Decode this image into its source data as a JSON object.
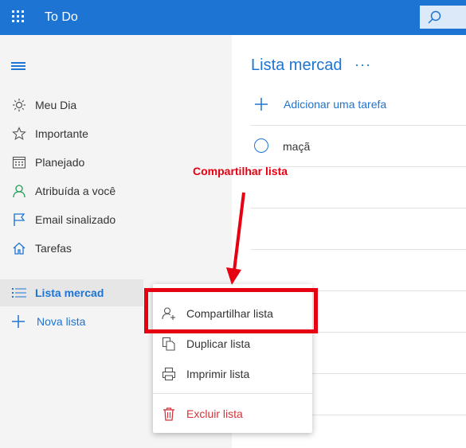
{
  "app": {
    "title": "To Do"
  },
  "colors": {
    "brand": "#1e74d2",
    "annotation": "#e60012",
    "danger": "#d13438",
    "sidebar_bg": "#f4f4f4"
  },
  "sidebar": {
    "items": [
      {
        "label": "Meu Dia",
        "icon": "sun-icon"
      },
      {
        "label": "Importante",
        "icon": "star-icon"
      },
      {
        "label": "Planejado",
        "icon": "calendar-icon"
      },
      {
        "label": "Atribuída a você",
        "icon": "person-icon"
      },
      {
        "label": "Email sinalizado",
        "icon": "flag-icon"
      },
      {
        "label": "Tarefas",
        "icon": "home-icon"
      }
    ],
    "active_list": {
      "label": "Lista mercad",
      "icon": "list-icon"
    },
    "new_list": {
      "label": "Nova lista",
      "icon": "plus-icon"
    }
  },
  "main": {
    "list_title": "Lista mercad",
    "more": "···",
    "add_task": "Adicionar uma tarefa",
    "tasks": [
      {
        "label": "maçã"
      }
    ]
  },
  "context_menu": {
    "items": [
      {
        "label": "Compartilhar lista",
        "icon": "share-person-icon"
      },
      {
        "label": "Duplicar lista",
        "icon": "duplicate-icon"
      },
      {
        "label": "Imprimir lista",
        "icon": "printer-icon"
      },
      {
        "label": "Excluir lista",
        "icon": "trash-icon"
      }
    ]
  },
  "annotation": {
    "text": "Compartilhar lista"
  }
}
